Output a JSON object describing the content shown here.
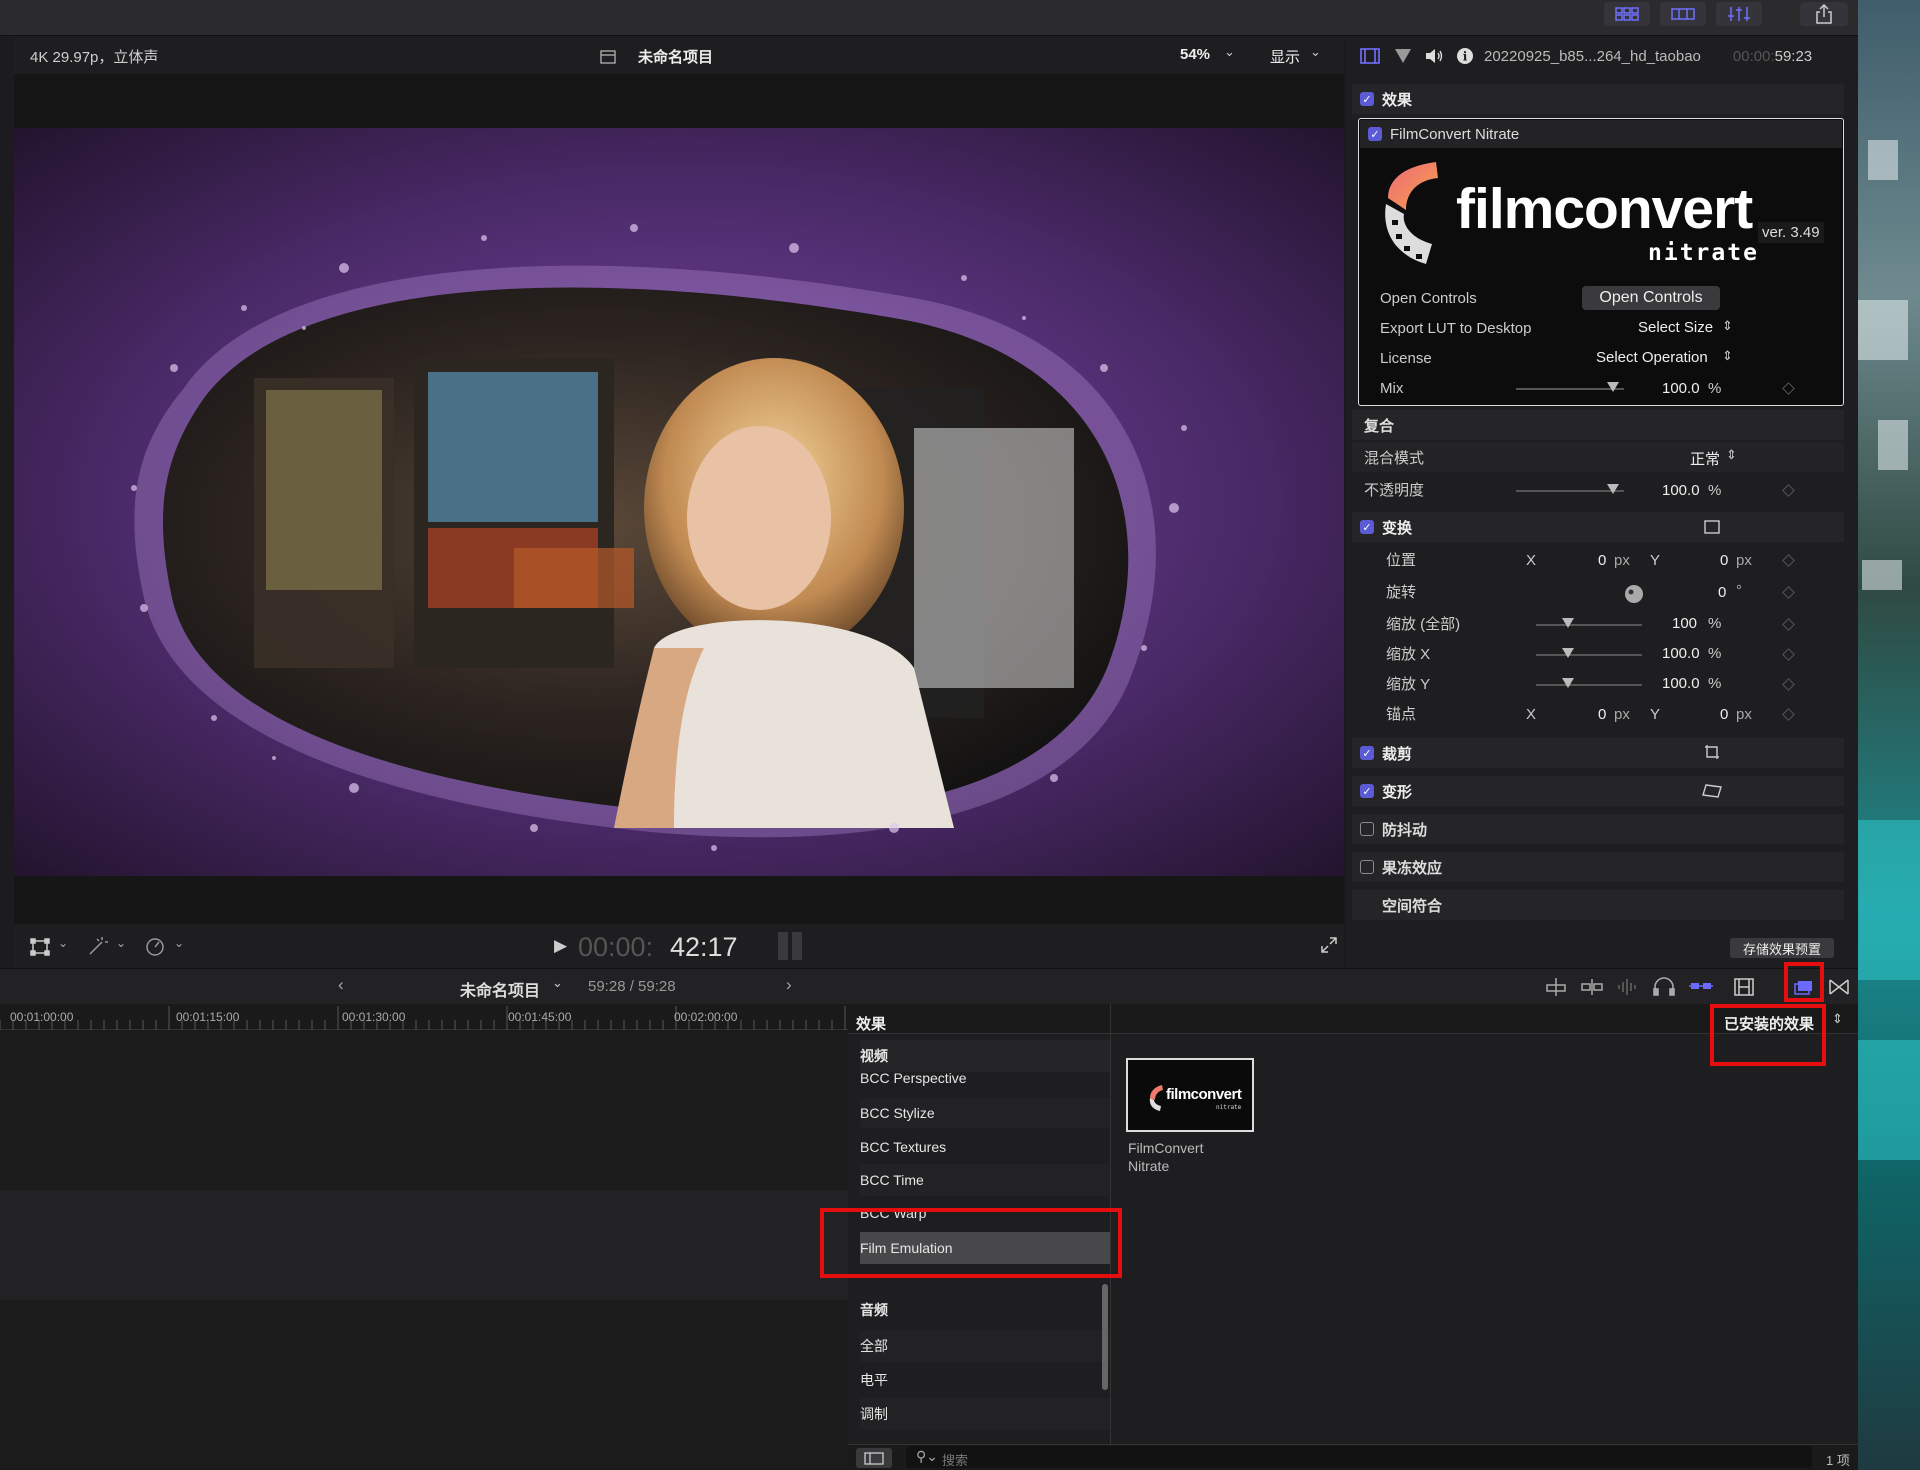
{
  "viewer": {
    "format": "4K 29.97p，立体声",
    "project_title": "未命名项目",
    "zoom": "54%",
    "display_label": "显示",
    "timecode_dim": "00:00:",
    "timecode": "42:17"
  },
  "inspector": {
    "clip_name": "20220925_b85...264_hd_taobao",
    "duration_dim": "00:00:",
    "duration": "59:23",
    "effects_label": "效果",
    "plugin_name": "FilmConvert Nitrate",
    "logo_main": "filmconvert",
    "logo_sub": "nitrate",
    "version": "ver. 3.49",
    "open_controls_label": "Open Controls",
    "open_controls_button": "Open Controls",
    "export_lut_label": "Export LUT to Desktop",
    "export_lut_value": "Select Size",
    "license_label": "License",
    "license_value": "Select Operation",
    "mix_label": "Mix",
    "mix_value": "100.0",
    "mix_unit": "%",
    "composite_label": "复合",
    "blend_mode_label": "混合模式",
    "blend_mode_value": "正常",
    "opacity_label": "不透明度",
    "opacity_value": "100.0",
    "opacity_unit": "%",
    "transform_label": "变换",
    "position_label": "位置",
    "x_label": "X",
    "y_label": "Y",
    "pos_x": "0",
    "pos_y": "0",
    "px": "px",
    "rotation_label": "旋转",
    "rotation_value": "0",
    "rotation_unit": "°",
    "scale_all_label": "缩放 (全部)",
    "scale_all_value": "100",
    "scale_x_label": "缩放 X",
    "scale_x_value": "100.0",
    "scale_y_label": "缩放 Y",
    "scale_y_value": "100.0",
    "pct": "%",
    "anchor_label": "锚点",
    "anchor_x": "0",
    "anchor_y": "0",
    "crop_label": "裁剪",
    "distort_label": "变形",
    "stabilize_label": "防抖动",
    "rolling_shutter_label": "果冻效应",
    "spatial_label": "空间符合",
    "save_preset_button": "存储效果预置",
    "mix_level": 0.9,
    "opacity_level": 0.9,
    "scale_level": 0.3
  },
  "timeline": {
    "project_title": "未命名项目",
    "duration": "59:28 / 59:28",
    "ruler": [
      "00:01:00:00",
      "00:01:15:00",
      "00:01:30:00",
      "00:01:45:00",
      "00:02:00:00"
    ]
  },
  "browser": {
    "title": "效果",
    "filter": "已安装的效果",
    "video_header": "视频",
    "video_items": [
      "BCC Perspective",
      "BCC Stylize",
      "BCC Textures",
      "BCC Time",
      "BCC Warp",
      "Film Emulation"
    ],
    "audio_header": "音频",
    "audio_items": [
      "全部",
      "电平",
      "调制"
    ],
    "thumb_logo": "filmconvert",
    "thumb_sub": "nitrate",
    "thumb_name_1": "FilmConvert",
    "thumb_name_2": "Nitrate",
    "search_placeholder": "搜索",
    "count": "1 项"
  },
  "colors": {
    "accent": "#5b5bd6",
    "highlight": "#e50d0d"
  }
}
